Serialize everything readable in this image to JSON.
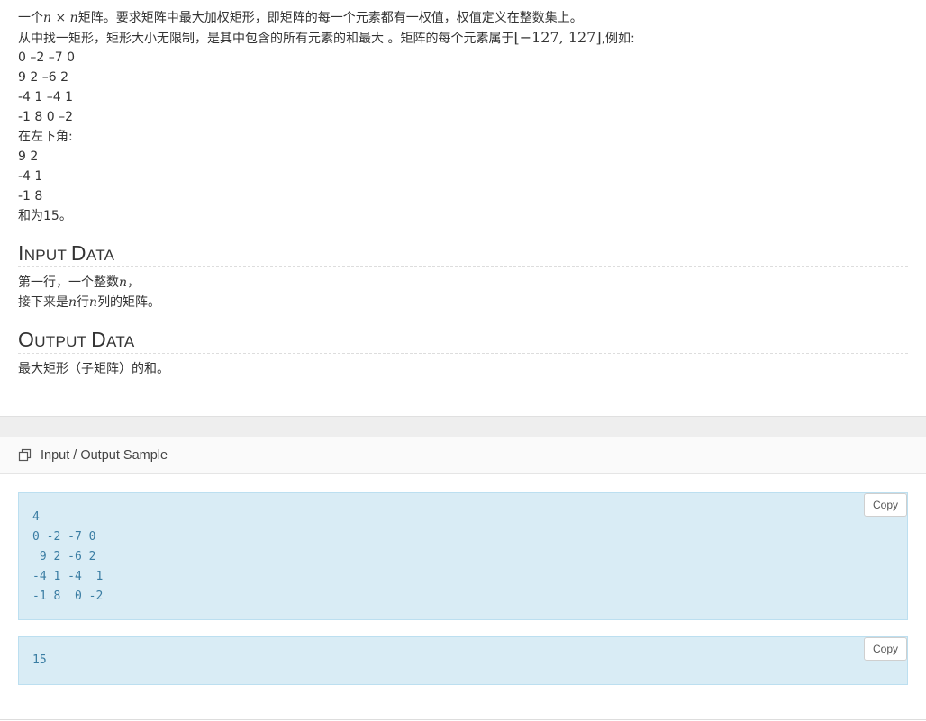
{
  "description": {
    "line1_pre": "一个",
    "line1_math_a": "n",
    "line1_times": " × ",
    "line1_math_b": "n",
    "line1_post": "矩阵。要求矩阵中最大加权矩形，即矩阵的每一个元素都有一权值，权值定义在整数集上。",
    "line2_pre": "从中找一矩形，矩形大小无限制，是其中包含的所有元素的和最大 。矩阵的每个元素属于",
    "line2_math": "[−127, 127]",
    "line2_post": ",例如:",
    "example_rows": [
      "0 –2 –7 0",
      "9 2 –6 2",
      "-4 1 –4 1",
      "-1 8 0 –2"
    ],
    "corner_label": "在左下角:",
    "sub_rows": [
      "9 2",
      "-4 1",
      "-1 8"
    ],
    "sum_text": "和为15。"
  },
  "input_section": {
    "title_first": "I",
    "title_rest1": "NPUT ",
    "title_second": "D",
    "title_rest2": "ATA",
    "line1_pre": "第一行，一个整数",
    "line1_math": "n",
    "line1_post": "，",
    "line2_pre": "接下来是",
    "line2_math_a": "n",
    "line2_mid": "行",
    "line2_math_b": "n",
    "line2_post": "列的矩阵。"
  },
  "output_section": {
    "title_first": "O",
    "title_rest1": "UTPUT ",
    "title_second": "D",
    "title_rest2": "ATA",
    "line1": "最大矩形（子矩阵）的和。"
  },
  "sample_panel": {
    "header_icon": "copy-documents-icon",
    "header_label": "Input / Output Sample",
    "input_text": "4\n0 -2 -7 0\n 9 2 -6 2\n-4 1 -4  1\n-1 8  0 -2",
    "output_text": "15",
    "copy_label": "Copy"
  },
  "colors": {
    "code_bg": "#d9ecf5",
    "code_border": "#bcdff0",
    "code_text": "#3a7da3",
    "band": "#eeeeee"
  }
}
